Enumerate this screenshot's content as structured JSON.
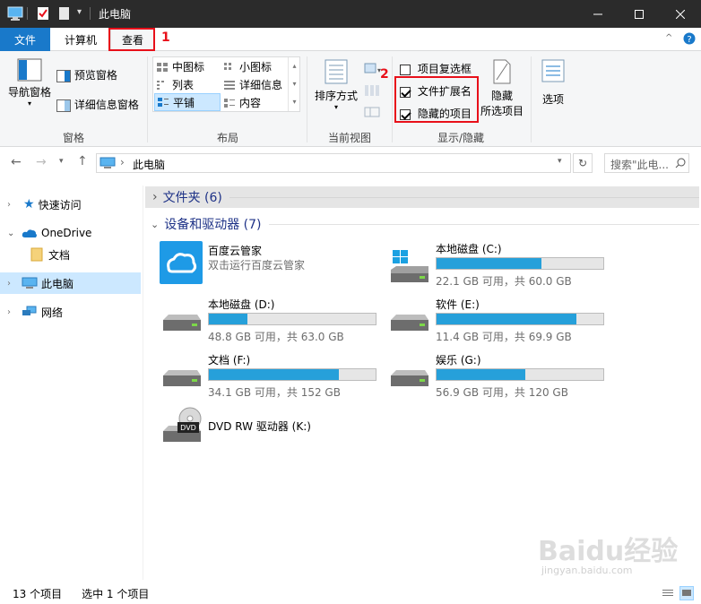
{
  "window": {
    "title": "此电脑"
  },
  "ribbon_tabs": {
    "file": "文件",
    "computer": "计算机",
    "view": "查看"
  },
  "annotations": {
    "one": "1",
    "two": "2"
  },
  "ribbon": {
    "pane_group": {
      "nav_pane": "导航窗格",
      "preview_pane": "预览窗格",
      "details_pane": "详细信息窗格",
      "label": "窗格"
    },
    "layout_group": {
      "items": [
        "中图标",
        "小图标",
        "列表",
        "详细信息",
        "平铺",
        "内容"
      ],
      "label": "布局"
    },
    "current_view_group": {
      "sort_by": "排序方式",
      "label": "当前视图"
    },
    "show_hide_group": {
      "item_checkboxes": "项目复选框",
      "file_extensions": "文件扩展名",
      "hidden_items": "隐藏的项目",
      "hide_selected_1": "隐藏",
      "hide_selected_2": "所选项目",
      "label": "显示/隐藏"
    },
    "options": "选项"
  },
  "checkbox_states": {
    "item_checkboxes": false,
    "file_extensions": true,
    "hidden_items": true
  },
  "address": {
    "path": "此电脑",
    "search_placeholder": "搜索\"此电..."
  },
  "sidebar": {
    "items": [
      {
        "label": "快速访问"
      },
      {
        "label": "OneDrive"
      },
      {
        "label": "文档"
      },
      {
        "label": "此电脑"
      },
      {
        "label": "网络"
      }
    ]
  },
  "content": {
    "folders_header": "文件夹 (6)",
    "devices_header": "设备和驱动器 (7)",
    "app": {
      "name": "百度云管家",
      "sub": "双击运行百度云管家"
    },
    "drives": [
      {
        "name": "本地磁盘 (C:)",
        "info": "22.1 GB 可用，共 60.0 GB",
        "used_fraction": 0.63
      },
      {
        "name": "本地磁盘 (D:)",
        "info": "48.8 GB 可用，共 63.0 GB",
        "used_fraction": 0.23
      },
      {
        "name": "软件 (E:)",
        "info": "11.4 GB 可用，共 69.9 GB",
        "used_fraction": 0.84
      },
      {
        "name": "文档 (F:)",
        "info": "34.1 GB 可用，共 152 GB",
        "used_fraction": 0.78
      },
      {
        "name": "娱乐 (G:)",
        "info": "56.9 GB 可用，共 120 GB",
        "used_fraction": 0.53
      }
    ],
    "dvd": {
      "name": "DVD RW 驱动器 (K:)",
      "badge": "DVD"
    }
  },
  "status": {
    "count": "13 个项目",
    "selected": "选中 1 个项目"
  },
  "watermark": {
    "main": "Baidu经验",
    "sub": "jingyan.baidu.com"
  },
  "colors": {
    "accent": "#1979ca",
    "bar_fill": "#26a0da",
    "highlight": "#e8101a"
  }
}
